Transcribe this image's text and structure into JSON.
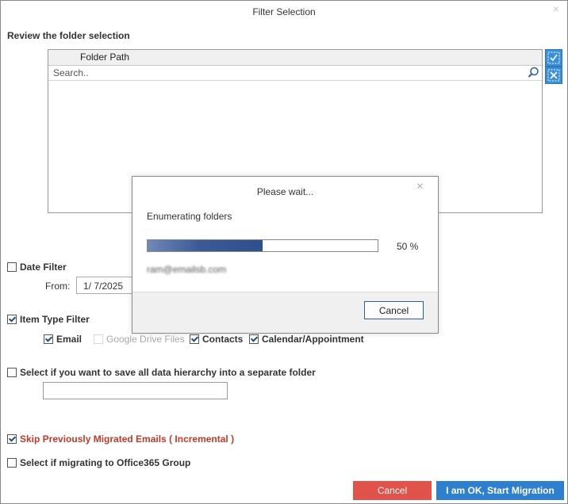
{
  "window": {
    "title": "Filter Selection",
    "close_glyph": "×"
  },
  "folder_selection": {
    "section_title": "Review the folder selection",
    "column_header": "Folder Path",
    "search_placeholder": "Search..",
    "side_buttons": {
      "check_all_icon": "check-all-icon",
      "uncheck_all_icon": "uncheck-all-icon"
    }
  },
  "date_filter": {
    "label": "Date Filter",
    "checked": false,
    "from_label": "From:",
    "from_value": "1/  7/2025"
  },
  "item_type_filter": {
    "label": "Item Type Filter",
    "checked": true,
    "items": [
      {
        "label": "Email",
        "checked": true,
        "enabled": true
      },
      {
        "label": "Google Drive Files",
        "checked": false,
        "enabled": false
      },
      {
        "label": "Contacts",
        "checked": true,
        "enabled": true
      },
      {
        "label": "Calendar/Appointment",
        "checked": true,
        "enabled": true
      }
    ]
  },
  "hierarchy_option": {
    "label": "Select if you want to save all data hierarchy into a separate folder",
    "checked": false,
    "folder_name_value": ""
  },
  "skip_migrated": {
    "label": "Skip Previously Migrated Emails ( Incremental )",
    "checked": true
  },
  "office365_group": {
    "label": "Select if migrating to Office365 Group",
    "checked": false
  },
  "footer": {
    "cancel_label": "Cancel",
    "start_label": "I am OK, Start Migration"
  },
  "modal": {
    "title": "Please wait...",
    "close_glyph": "×",
    "status_text": "Enumerating folders",
    "progress_percent": 50,
    "progress_text": "50 %",
    "account": "ram@emailsb.com",
    "cancel_label": "Cancel"
  },
  "colors": {
    "accent": "#2f7fd1",
    "danger": "#e0524a",
    "progress": "#3b5a97",
    "incremental_text": "#c0392b"
  }
}
